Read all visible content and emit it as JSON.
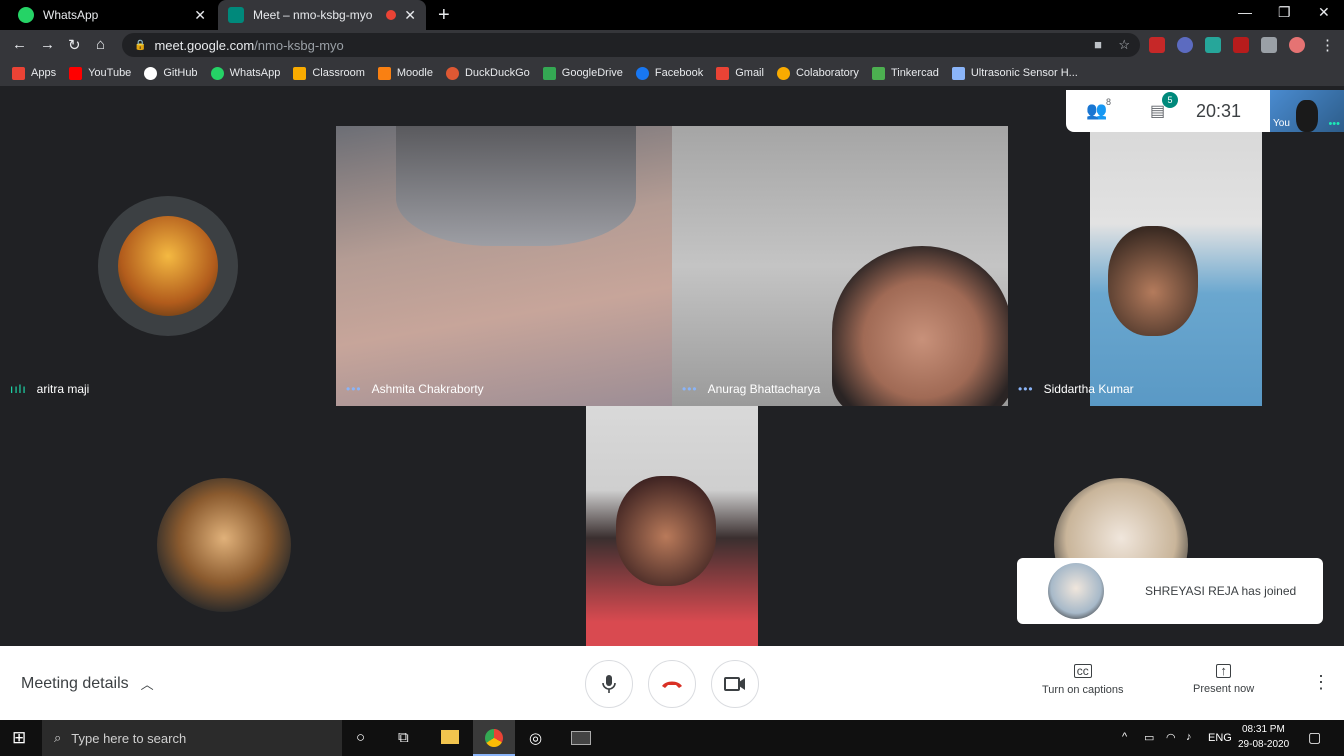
{
  "browser": {
    "tabs": [
      {
        "title": "WhatsApp",
        "active": false
      },
      {
        "title": "Meet – nmo-ksbg-myo",
        "active": true
      }
    ],
    "url_host": "meet.google.com",
    "url_path": "/nmo-ksbg-myo"
  },
  "bookmarks": [
    {
      "label": "Apps",
      "icon": "apps-grid-icon",
      "color": "#ea4335"
    },
    {
      "label": "YouTube",
      "icon": "youtube-icon",
      "color": "#ff0000"
    },
    {
      "label": "GitHub",
      "icon": "github-icon",
      "color": "#ffffff"
    },
    {
      "label": "WhatsApp",
      "icon": "whatsapp-icon",
      "color": "#25d366"
    },
    {
      "label": "Classroom",
      "icon": "classroom-icon",
      "color": "#f9ab00"
    },
    {
      "label": "Moodle",
      "icon": "moodle-icon",
      "color": "#f98012"
    },
    {
      "label": "DuckDuckGo",
      "icon": "duckduckgo-icon",
      "color": "#de5833"
    },
    {
      "label": "GoogleDrive",
      "icon": "google-drive-icon",
      "color": "#34a853"
    },
    {
      "label": "Facebook",
      "icon": "facebook-icon",
      "color": "#1877f2"
    },
    {
      "label": "Gmail",
      "icon": "gmail-icon",
      "color": "#ea4335"
    },
    {
      "label": "Colaboratory",
      "icon": "colab-icon",
      "color": "#f9ab00"
    },
    {
      "label": "Tinkercad",
      "icon": "tinkercad-icon",
      "color": "#4caf50"
    },
    {
      "label": "Ultrasonic Sensor H...",
      "icon": "instructables-icon",
      "color": "#8ab4f8"
    }
  ],
  "meet": {
    "participants_count": "8",
    "chat_badge": "5",
    "time": "20:31",
    "self_label": "You",
    "participants": [
      {
        "name": "aritra maji",
        "speaking": true
      },
      {
        "name": "Ashmita Chakraborty"
      },
      {
        "name": "Anurag Bhattacharya"
      },
      {
        "name": "Siddartha Kumar"
      }
    ],
    "toast": "SHREYASI REJA has joined",
    "meeting_details": "Meeting details",
    "captions_label": "Turn on captions",
    "present_label": "Present now"
  },
  "taskbar": {
    "search_placeholder": "Type here to search",
    "lang": "ENG",
    "clock_time": "08:31 PM",
    "clock_date": "29-08-2020"
  },
  "colors": {
    "meet_bg": "#202124",
    "accent": "#00897b",
    "hangup": "#d93025"
  }
}
